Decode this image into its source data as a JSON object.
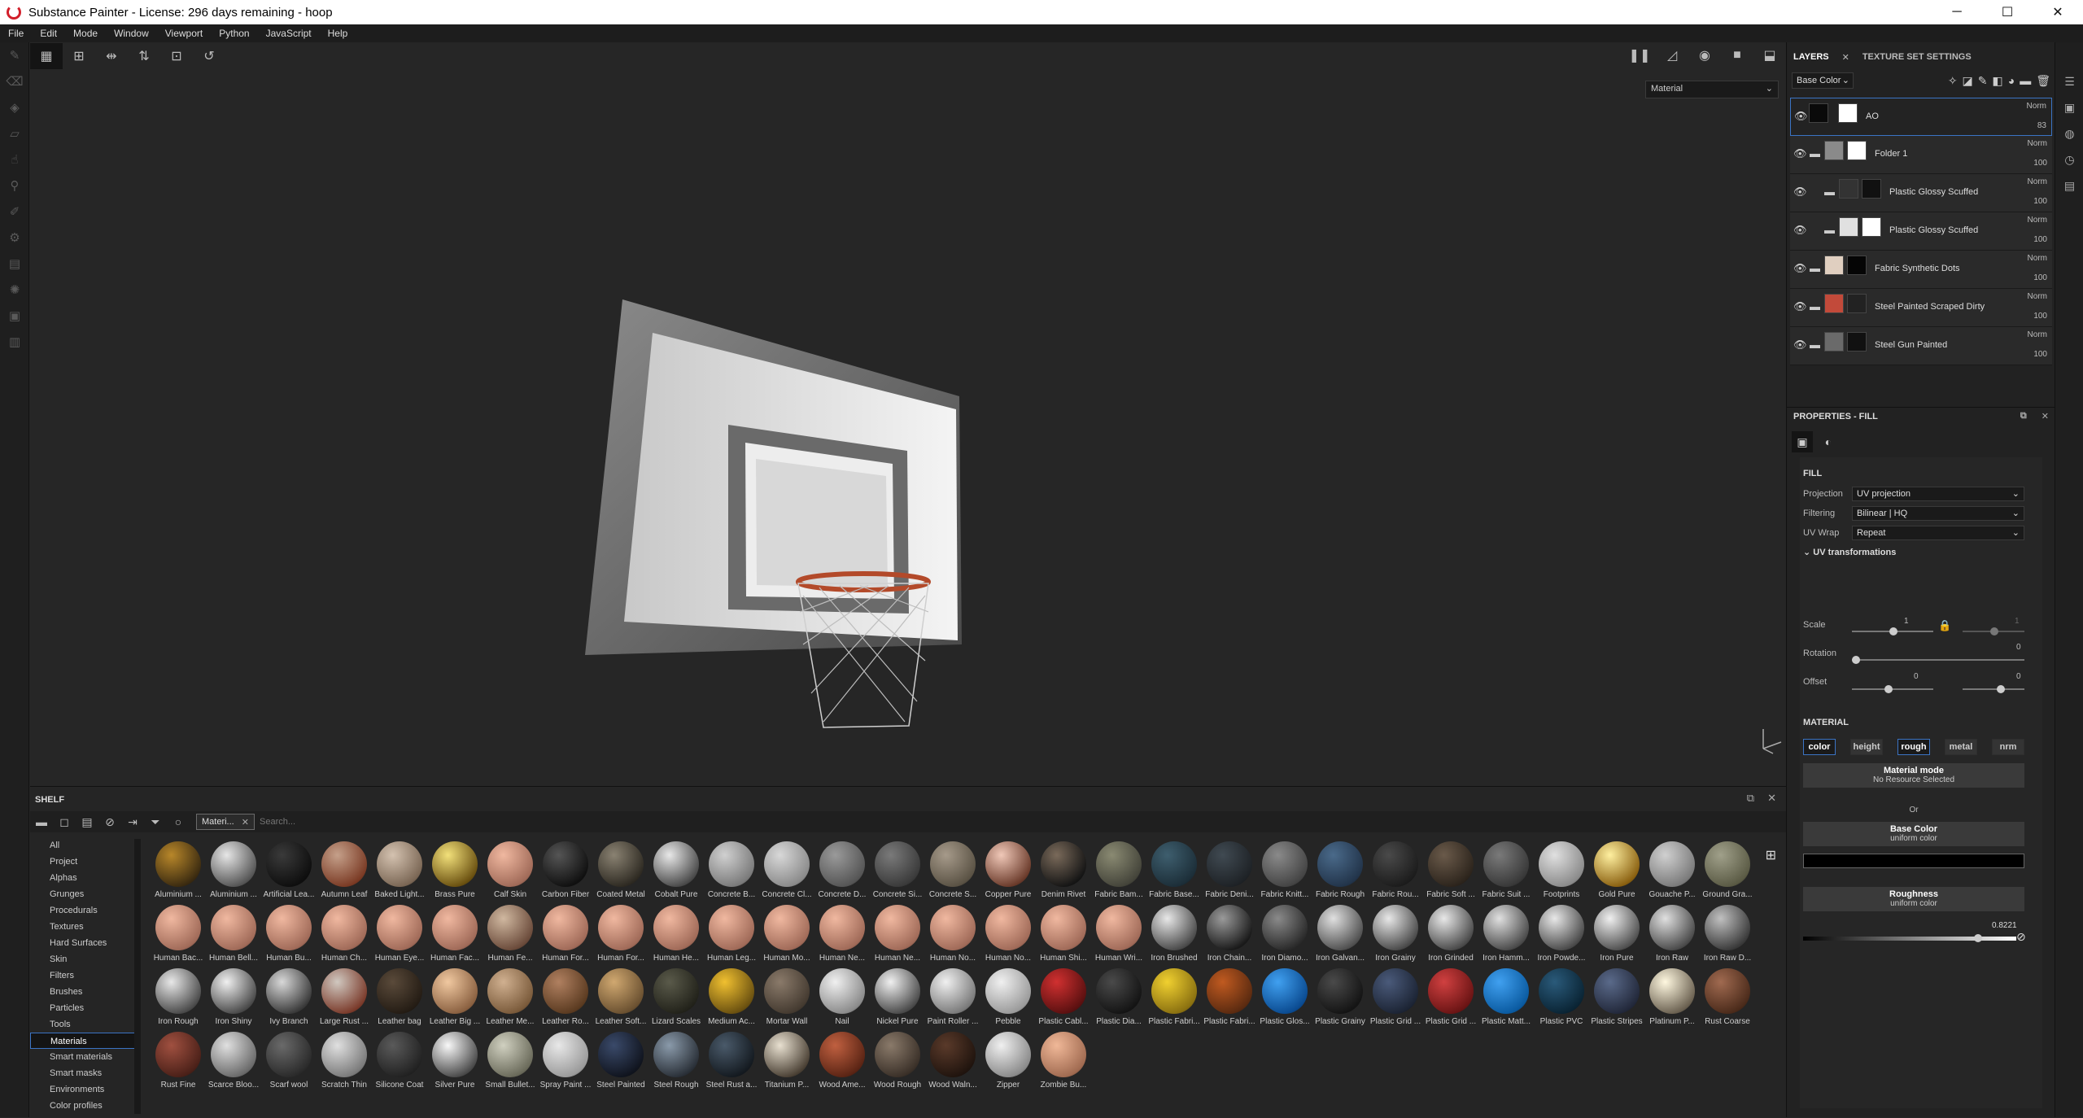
{
  "window": {
    "title": "Substance Painter - License: 296 days remaining - hoop",
    "controls": [
      "─",
      "☐",
      "✕"
    ]
  },
  "menu": [
    "File",
    "Edit",
    "Mode",
    "Window",
    "Viewport",
    "Python",
    "JavaScript",
    "Help"
  ],
  "viewport": {
    "mode_select": "Material"
  },
  "shelf": {
    "title": "SHELF",
    "filter_chip": "Materi...",
    "search_placeholder": "Search...",
    "categories": [
      "All",
      "Project",
      "Alphas",
      "Grunges",
      "Procedurals",
      "Textures",
      "Hard Surfaces",
      "Skin",
      "Filters",
      "Brushes",
      "Particles",
      "Tools",
      "Materials",
      "Smart materials",
      "Smart masks",
      "Environments",
      "Color profiles"
    ],
    "active_category": "Materials",
    "materials": [
      [
        "Aluminium ...",
        "#b8872a",
        "#3a2a10"
      ],
      [
        "Aluminium ...",
        "#e6e6e6",
        "#555555"
      ],
      [
        "Artificial Lea...",
        "#3a3a3a",
        "#0e0e0e"
      ],
      [
        "Autumn Leaf",
        "#c5a08a",
        "#7a3a24"
      ],
      [
        "Baked Light...",
        "#d4c2b0",
        "#7a6654"
      ],
      [
        "Brass Pure",
        "#f2e07a",
        "#6a5010"
      ],
      [
        "Calf Skin",
        "#f0b8a0",
        "#a06a58"
      ],
      [
        "Carbon Fiber",
        "#555555",
        "#101010"
      ],
      [
        "Coated Metal",
        "#8a8272",
        "#2e2a22"
      ],
      [
        "Cobalt Pure",
        "#e8e8e8",
        "#4a4a4a"
      ],
      [
        "Concrete B...",
        "#d0d0d0",
        "#7a7a7a"
      ],
      [
        "Concrete Cl...",
        "#d8d8d8",
        "#8a8a8a"
      ],
      [
        "Concrete D...",
        "#9a9a9a",
        "#555555"
      ],
      [
        "Concrete Si...",
        "#7a7a7a",
        "#3a3a3a"
      ],
      [
        "Concrete S...",
        "#a69a8a",
        "#5a5244"
      ],
      [
        "Copper Pure",
        "#f0c8b8",
        "#6a3a2a"
      ],
      [
        "Denim Rivet",
        "#7a6a5a",
        "#151515"
      ],
      [
        "Fabric Bam...",
        "#8a8a72",
        "#44443a"
      ],
      [
        "Fabric Base...",
        "#3e5e6e",
        "#1c2e38"
      ],
      [
        "Fabric Deni...",
        "#404a52",
        "#1e2226"
      ],
      [
        "Fabric Knitt...",
        "#8a8a8a",
        "#444444"
      ],
      [
        "Fabric Rough",
        "#4a6a8a",
        "#22344a"
      ],
      [
        "Fabric Rou...",
        "#4a4a4a",
        "#1c1c1c"
      ],
      [
        "Fabric Soft ...",
        "#6a5a4a",
        "#2c241c"
      ],
      [
        "Fabric Suit ...",
        "#7a7a7a",
        "#383838"
      ],
      [
        "Footprints",
        "#e0e0e0",
        "#8a8a8a"
      ],
      [
        "Gold Pure",
        "#fff0a0",
        "#8a6010"
      ],
      [
        "Gouache P...",
        "#d0d0d0",
        "#7a7a7a"
      ],
      [
        "Ground Gra...",
        "#a0a08a",
        "#5a5a44"
      ],
      [
        "Human Bac...",
        "#f0b8a0",
        "#a06a58"
      ],
      [
        "Human Bell...",
        "#f0b8a0",
        "#a06a58"
      ],
      [
        "Human Bu...",
        "#f0b8a0",
        "#a06a58"
      ],
      [
        "Human Ch...",
        "#f0b8a0",
        "#a06a58"
      ],
      [
        "Human Eye...",
        "#f0b8a0",
        "#a06a58"
      ],
      [
        "Human Fac...",
        "#f0b8a0",
        "#a06a58"
      ],
      [
        "Human Fe...",
        "#d0b8a0",
        "#6a4a3a"
      ],
      [
        "Human For...",
        "#f0b8a0",
        "#a06a58"
      ],
      [
        "Human For...",
        "#f0b8a0",
        "#a06a58"
      ],
      [
        "Human He...",
        "#f0b8a0",
        "#a06a58"
      ],
      [
        "Human Leg...",
        "#f0b8a0",
        "#a06a58"
      ],
      [
        "Human Mo...",
        "#f0b8a0",
        "#a06a58"
      ],
      [
        "Human Ne...",
        "#f0b8a0",
        "#a06a58"
      ],
      [
        "Human Ne...",
        "#f0b8a0",
        "#a06a58"
      ],
      [
        "Human No...",
        "#f0b8a0",
        "#a06a58"
      ],
      [
        "Human No...",
        "#f0b8a0",
        "#a06a58"
      ],
      [
        "Human Shi...",
        "#f0b8a0",
        "#a06a58"
      ],
      [
        "Human Wri...",
        "#f0b8a0",
        "#a06a58"
      ],
      [
        "Iron Brushed",
        "#e8e8e8",
        "#4a4a4a"
      ],
      [
        "Iron Chain...",
        "#9a9a9a",
        "#1a1a1a"
      ],
      [
        "Iron Diamo...",
        "#8a8a8a",
        "#2a2a2a"
      ],
      [
        "Iron Galvan...",
        "#e0e0e0",
        "#505050"
      ],
      [
        "Iron Grainy",
        "#e8e8e8",
        "#4a4a4a"
      ],
      [
        "Iron Grinded",
        "#e8e8e8",
        "#4a4a4a"
      ],
      [
        "Iron Hamm...",
        "#e0e0e0",
        "#4a4a4a"
      ],
      [
        "Iron Powde...",
        "#e8e8e8",
        "#4a4a4a"
      ],
      [
        "Iron Pure",
        "#f0f0f0",
        "#505050"
      ],
      [
        "Iron Raw",
        "#e0e0e0",
        "#4a4a4a"
      ],
      [
        "Iron Raw D...",
        "#c0c0c0",
        "#3a3a3a"
      ],
      [
        "Iron Rough",
        "#e8e8e8",
        "#4a4a4a"
      ],
      [
        "Iron Shiny",
        "#f0f0f0",
        "#4a4a4a"
      ],
      [
        "Ivy Branch",
        "#d8d8d8",
        "#3a3a3a"
      ],
      [
        "Large Rust ...",
        "#d0c8c0",
        "#7a3a2a"
      ],
      [
        "Leather bag",
        "#5a4a3a",
        "#241c14"
      ],
      [
        "Leather Big ...",
        "#f0c8a0",
        "#8a6040"
      ],
      [
        "Leather Me...",
        "#d0b090",
        "#7a5a3a"
      ],
      [
        "Leather Ro...",
        "#b08060",
        "#5a3a20"
      ],
      [
        "Leather Soft...",
        "#d0a870",
        "#6a5030"
      ],
      [
        "Lizard Scales",
        "#5a5a4a",
        "#22221a"
      ],
      [
        "Medium Ac...",
        "#f0c030",
        "#6a5010"
      ],
      [
        "Mortar Wall",
        "#8a7a6a",
        "#443a30"
      ],
      [
        "Nail",
        "#f0f0f0",
        "#8a8a8a"
      ],
      [
        "Nickel Pure",
        "#f0f0f0",
        "#4a4a4a"
      ],
      [
        "Paint Roller ...",
        "#f0f0f0",
        "#7a7a7a"
      ],
      [
        "Pebble",
        "#f0f0f0",
        "#9a9a9a"
      ],
      [
        "Plastic Cabl...",
        "#d03030",
        "#5a1010"
      ],
      [
        "Plastic Dia...",
        "#4a4a4a",
        "#141414"
      ],
      [
        "Plastic Fabri...",
        "#f0d030",
        "#8a7010"
      ],
      [
        "Plastic Fabri...",
        "#c05a20",
        "#5a2a10"
      ],
      [
        "Plastic Glos...",
        "#40a0f0",
        "#0a4a90"
      ],
      [
        "Plastic Grainy",
        "#4a4a4a",
        "#141414"
      ],
      [
        "Plastic Grid ...",
        "#4a5a7a",
        "#1c2434"
      ],
      [
        "Plastic Grid ...",
        "#d04040",
        "#6a1414"
      ],
      [
        "Plastic Matt...",
        "#40a0f0",
        "#0a5aa0"
      ],
      [
        "Plastic PVC",
        "#2a5a7a",
        "#0a2434"
      ],
      [
        "Plastic Stripes",
        "#5a6a8a",
        "#22283a"
      ],
      [
        "Platinum P...",
        "#fff8e0",
        "#6a6050"
      ],
      [
        "Rust Coarse",
        "#a06a50",
        "#4a2a1a"
      ],
      [
        "Rust Fine",
        "#a05040",
        "#4a2018"
      ],
      [
        "Scarce Bloo...",
        "#e0e0e0",
        "#6a6a6a"
      ],
      [
        "Scarf wool",
        "#6a6a6a",
        "#2a2a2a"
      ],
      [
        "Scratch Thin",
        "#e0e0e0",
        "#7a7a7a"
      ],
      [
        "Silicone Coat",
        "#5a5a5a",
        "#222222"
      ],
      [
        "Silver Pure",
        "#f8f8f8",
        "#4a4a4a"
      ],
      [
        "Small Bullet...",
        "#d0d0c0",
        "#6a6a5a"
      ],
      [
        "Spray Paint ...",
        "#e8e8e8",
        "#9a9a9a"
      ],
      [
        "Steel Painted",
        "#3a4a6a",
        "#10141e"
      ],
      [
        "Steel Rough",
        "#8a9aaa",
        "#2a3038"
      ],
      [
        "Steel Rust a...",
        "#4a5a6a",
        "#141a20"
      ],
      [
        "Titanium P...",
        "#e8e0d0",
        "#4a4034"
      ],
      [
        "Wood Ame...",
        "#c06040",
        "#5a2414"
      ],
      [
        "Wood Rough",
        "#8a7a6a",
        "#3a3028"
      ],
      [
        "Wood Waln...",
        "#5a3a2a",
        "#20140e"
      ],
      [
        "Zipper",
        "#f0f0f0",
        "#8a8a8a"
      ],
      [
        "Zombie Bu...",
        "#f0b898",
        "#a06a50"
      ]
    ]
  },
  "layers_panel": {
    "tab_layers": "LAYERS",
    "tab_close": "✕",
    "tab_texture_set": "TEXTURE SET SETTINGS",
    "channel_select": "Base Color",
    "layers": [
      {
        "name": "AO",
        "blend": "Norm",
        "opacity": "83",
        "indent": 0,
        "folder": false,
        "thumb1": "#0a0a0a",
        "thumb2": "#ffffff",
        "selected": true
      },
      {
        "name": "Folder 1",
        "blend": "Norm",
        "opacity": "100",
        "indent": 0,
        "folder": true,
        "thumb1": "#8a8a8a",
        "thumb2": "#ffffff",
        "selected": false
      },
      {
        "name": "Plastic Glossy Scuffed",
        "blend": "Norm",
        "opacity": "100",
        "indent": 1,
        "folder": true,
        "thumb1": "#333333",
        "thumb2": "#111111",
        "selected": false
      },
      {
        "name": "Plastic Glossy Scuffed",
        "blend": "Norm",
        "opacity": "100",
        "indent": 1,
        "folder": true,
        "thumb1": "#e0e0e0",
        "thumb2": "#ffffff",
        "selected": false
      },
      {
        "name": "Fabric Synthetic Dots",
        "blend": "Norm",
        "opacity": "100",
        "indent": 0,
        "folder": true,
        "thumb1": "#e0cfc0",
        "thumb2": "#050505",
        "selected": false
      },
      {
        "name": "Steel Painted Scraped Dirty",
        "blend": "Norm",
        "opacity": "100",
        "indent": 0,
        "folder": true,
        "thumb1": "#c24a3a",
        "thumb2": "#222222",
        "selected": false
      },
      {
        "name": "Steel Gun Painted",
        "blend": "Norm",
        "opacity": "100",
        "indent": 0,
        "folder": true,
        "thumb1": "#6a6a6a",
        "thumb2": "#111111",
        "selected": false
      }
    ]
  },
  "properties": {
    "title": "PROPERTIES - FILL",
    "fill_title": "FILL",
    "projection_label": "Projection",
    "projection_value": "UV projection",
    "filtering_label": "Filtering",
    "filtering_value": "Bilinear | HQ",
    "uvwrap_label": "UV Wrap",
    "uvwrap_value": "Repeat",
    "uv_transformations": "UV transformations",
    "scale_label": "Scale",
    "scale_value": "1",
    "scale_value2": "1",
    "rotation_label": "Rotation",
    "rotation_value": "0",
    "offset_label": "Offset",
    "offset_x": "0",
    "offset_y": "0",
    "material_title": "MATERIAL",
    "channels": [
      "color",
      "height",
      "rough",
      "metal",
      "nrm"
    ],
    "material_mode_title": "Material mode",
    "material_mode_value": "No Resource Selected",
    "or_text": "Or",
    "base_color_title": "Base Color",
    "base_color_sub": "uniform color",
    "base_color": "#000000",
    "roughness_title": "Roughness",
    "roughness_sub": "uniform color",
    "roughness_value": "0.8221"
  }
}
